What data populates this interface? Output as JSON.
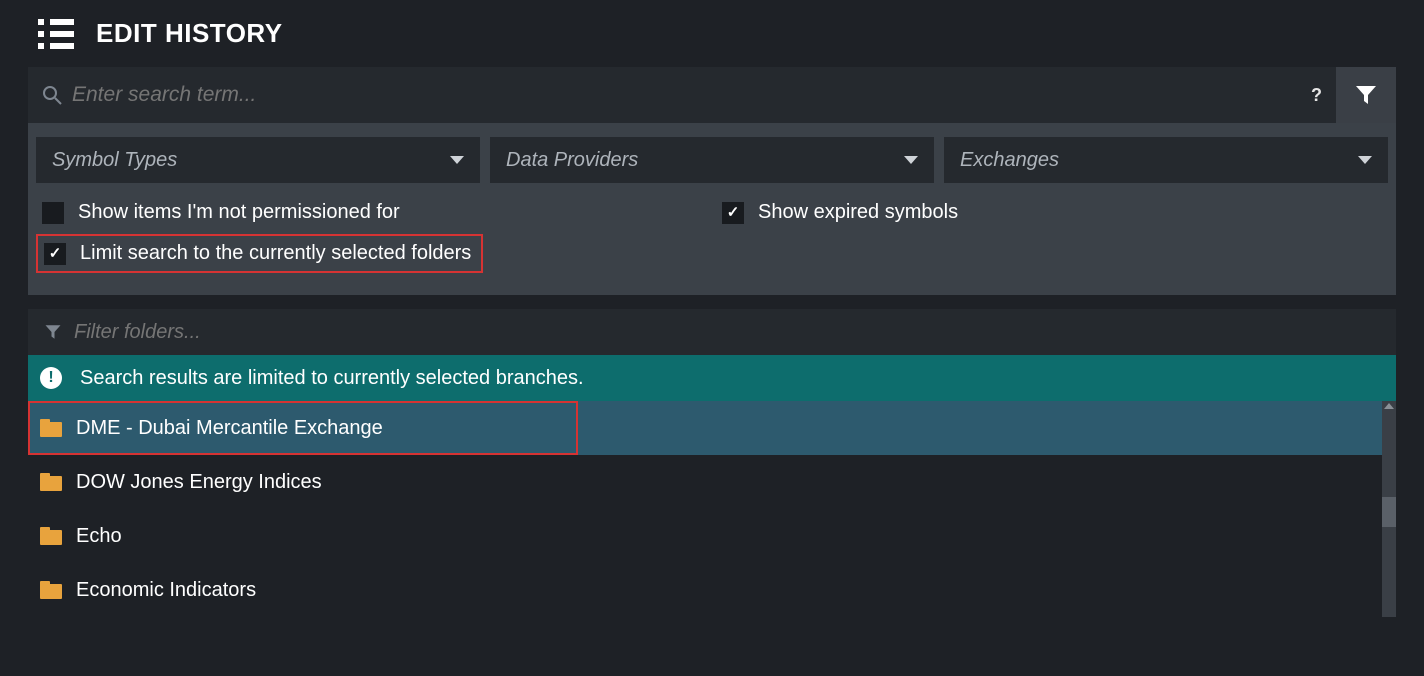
{
  "title": "EDIT HISTORY",
  "search": {
    "placeholder": "Enter search term...",
    "help": "?"
  },
  "dropdowns": {
    "symbol_types": "Symbol Types",
    "data_providers": "Data Providers",
    "exchanges": "Exchanges"
  },
  "checks": {
    "not_permissioned": {
      "label": "Show items I'm not permissioned for",
      "checked": false
    },
    "expired": {
      "label": "Show expired symbols",
      "checked": true
    },
    "limit_folders": {
      "label": "Limit search to the currently selected folders",
      "checked": true
    }
  },
  "folder_filter_placeholder": "Filter folders...",
  "banner": "Search results are limited to currently selected branches.",
  "folders": [
    {
      "name": "DME - Dubai Mercantile Exchange",
      "selected": true
    },
    {
      "name": "DOW Jones Energy Indices",
      "selected": false
    },
    {
      "name": "Echo",
      "selected": false
    },
    {
      "name": "Economic Indicators",
      "selected": false
    }
  ],
  "colors": {
    "accent_teal": "#0d6d6d",
    "highlight_red": "#d63333",
    "folder": "#e8a33d",
    "selected_row": "#2d5a6e"
  }
}
